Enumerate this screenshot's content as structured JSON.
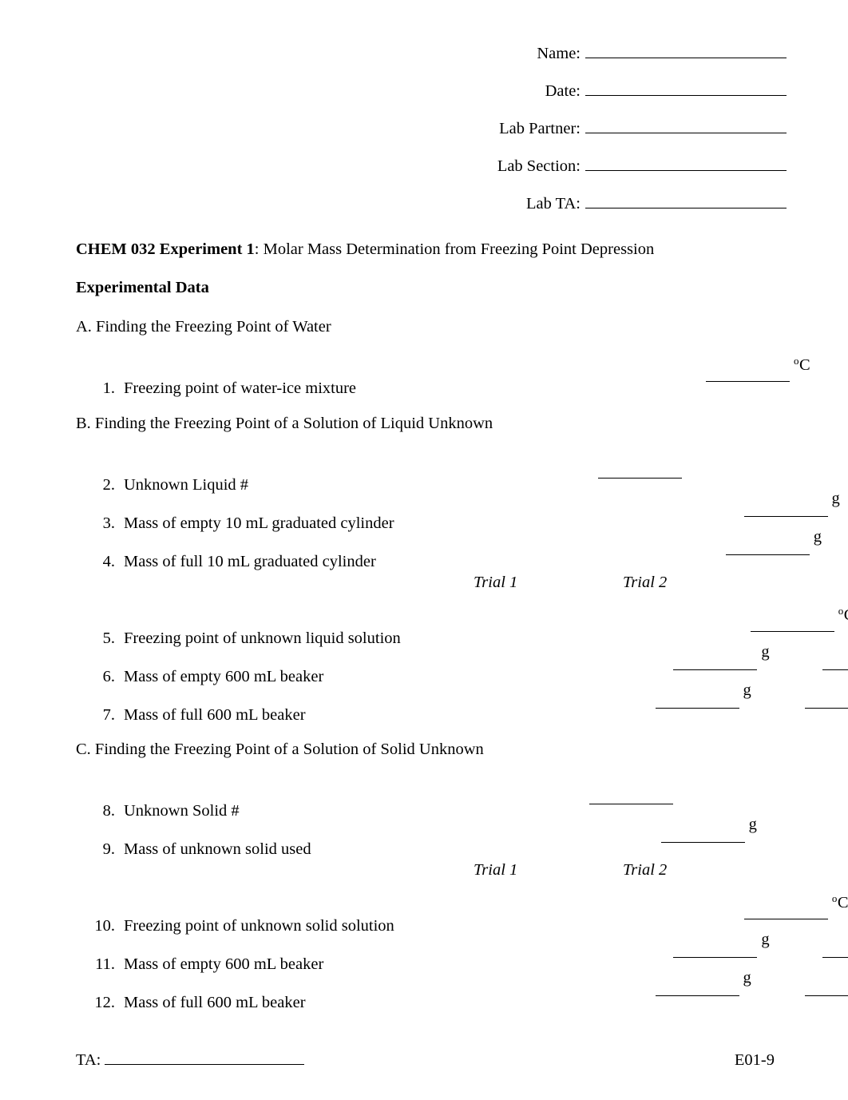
{
  "header_fields": [
    {
      "label": "Name:"
    },
    {
      "label": "Date:"
    },
    {
      "label": "Lab Partner:"
    },
    {
      "label": "Lab Section:"
    },
    {
      "label": "Lab TA:"
    }
  ],
  "title": {
    "bold_prefix": "CHEM 032 Experiment 1",
    "rest": ": Molar Mass Determination from Freezing Point Depression"
  },
  "section_heading": "Experimental Data",
  "trial_headers": {
    "trial1": "Trial 1",
    "trial2": "Trial 2"
  },
  "units": {
    "celsius_sup": "o",
    "celsius_base": "C",
    "grams": "g"
  },
  "groups": [
    {
      "heading": "A. Finding the Freezing Point of Water",
      "items": [
        {
          "num": "1.",
          "label": "Freezing point of water-ice mixture",
          "unit": "celsius",
          "columns": 1
        }
      ]
    },
    {
      "heading": "B. Finding the Freezing Point of a Solution of Liquid Unknown",
      "items": [
        {
          "num": "2.",
          "label": "Unknown Liquid #",
          "unit": "none",
          "columns": 1
        },
        {
          "num": "3.",
          "label": "Mass of empty 10 mL graduated cylinder",
          "unit": "grams",
          "columns": 1
        },
        {
          "num": "4.",
          "label": "Mass of full 10 mL graduated cylinder",
          "unit": "grams",
          "columns": 1
        }
      ],
      "trial_items": [
        {
          "num": "5.",
          "label": "Freezing point of unknown liquid solution",
          "unit": "celsius",
          "columns": 2
        },
        {
          "num": "6.",
          "label": "Mass of empty 600 mL beaker",
          "unit": "grams",
          "columns": 2
        },
        {
          "num": "7.",
          "label": "Mass of full 600 mL beaker",
          "unit": "grams",
          "columns": 2
        }
      ]
    },
    {
      "heading": "C. Finding the Freezing Point of a Solution of Solid Unknown",
      "items": [
        {
          "num": "8.",
          "label": "Unknown Solid #",
          "unit": "none",
          "columns": 1
        },
        {
          "num": "9.",
          "label": "Mass of unknown solid used",
          "unit": "grams",
          "columns": 1
        }
      ],
      "trial_items": [
        {
          "num": "10.",
          "label": "Freezing point of unknown solid solution",
          "unit": "celsius",
          "columns": 2
        },
        {
          "num": "11.",
          "label": "Mass of empty 600 mL beaker",
          "unit": "grams",
          "columns": 2
        },
        {
          "num": "12.",
          "label": "Mass of full 600 mL beaker",
          "unit": "grams",
          "columns": 2
        }
      ]
    }
  ],
  "footer": {
    "ta_label": "TA:",
    "page_code": "E01-9"
  }
}
